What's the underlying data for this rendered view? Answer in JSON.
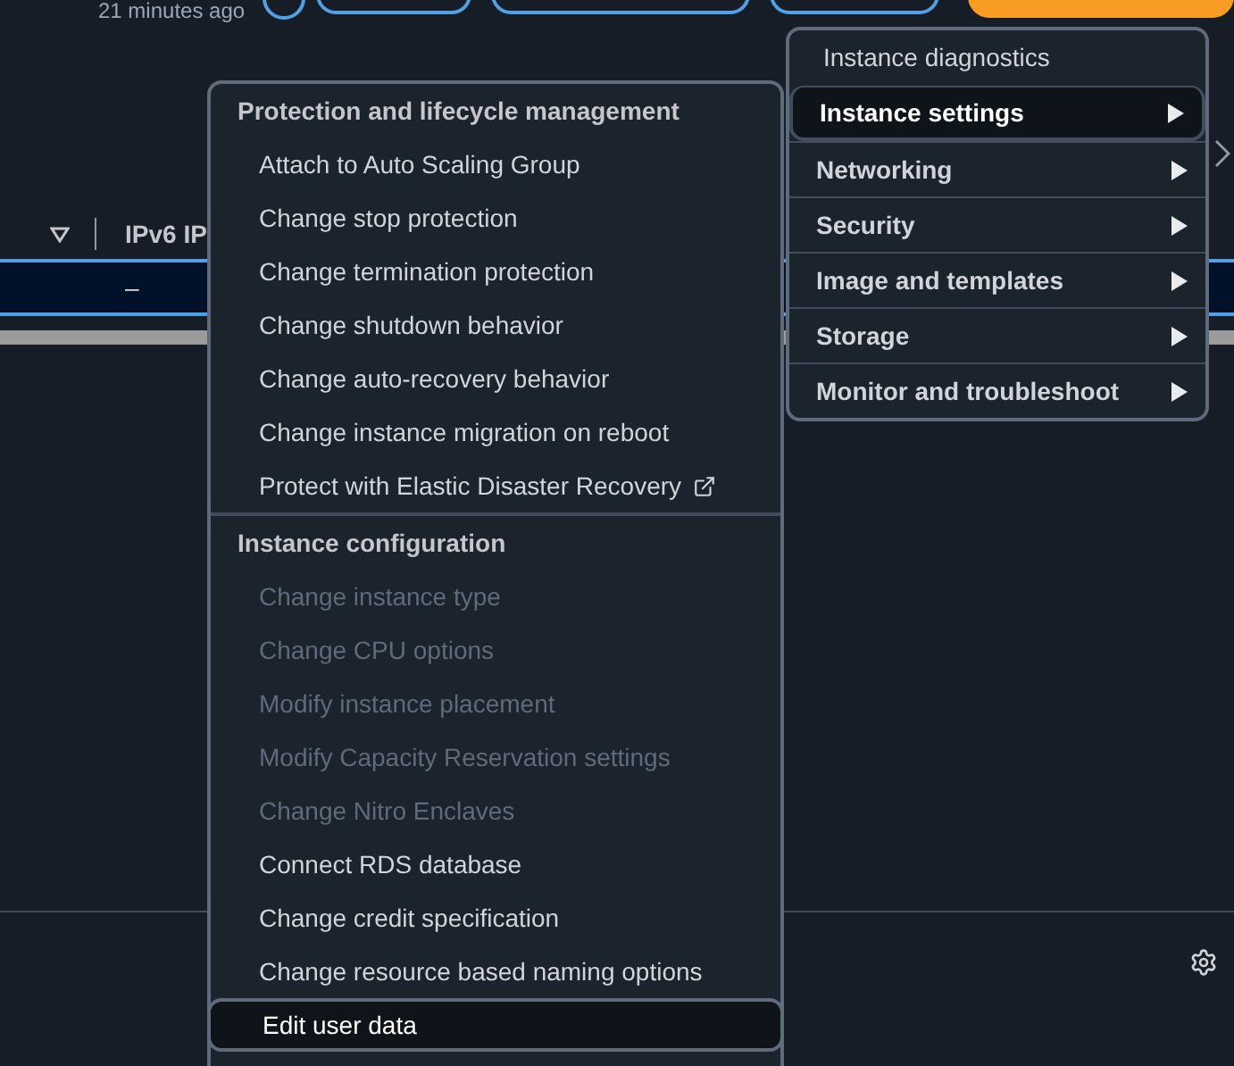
{
  "header": {
    "timestamp": "21 minutes ago"
  },
  "table": {
    "columns": [
      {
        "label": "IPv6 IP"
      }
    ],
    "rows": [
      {
        "cells": [
          "–"
        ],
        "selected": true
      }
    ]
  },
  "actions_menu": {
    "items": [
      {
        "label": "Instance diagnostics",
        "kind": "plain",
        "selected": false
      },
      {
        "label": "Instance settings",
        "kind": "submenu",
        "selected": true
      },
      {
        "label": "Networking",
        "kind": "submenu",
        "selected": false
      },
      {
        "label": "Security",
        "kind": "submenu",
        "selected": false
      },
      {
        "label": "Image and templates",
        "kind": "submenu",
        "selected": false
      },
      {
        "label": "Storage",
        "kind": "submenu",
        "selected": false
      },
      {
        "label": "Monitor and troubleshoot",
        "kind": "submenu",
        "selected": false
      }
    ]
  },
  "settings_submenu": {
    "groups": [
      {
        "title": "Protection and lifecycle management",
        "items": [
          {
            "label": "Attach to Auto Scaling Group",
            "disabled": false,
            "selected": false
          },
          {
            "label": "Change stop protection",
            "disabled": false,
            "selected": false
          },
          {
            "label": "Change termination protection",
            "disabled": false,
            "selected": false
          },
          {
            "label": "Change shutdown behavior",
            "disabled": false,
            "selected": false
          },
          {
            "label": "Change auto-recovery behavior",
            "disabled": false,
            "selected": false
          },
          {
            "label": "Change instance migration on reboot",
            "disabled": false,
            "selected": false
          },
          {
            "label": "Protect with Elastic Disaster Recovery",
            "disabled": false,
            "selected": false,
            "external": true
          }
        ]
      },
      {
        "title": "Instance configuration",
        "items": [
          {
            "label": "Change instance type",
            "disabled": true,
            "selected": false
          },
          {
            "label": "Change CPU options",
            "disabled": true,
            "selected": false
          },
          {
            "label": "Modify instance placement",
            "disabled": true,
            "selected": false
          },
          {
            "label": "Modify Capacity Reservation settings",
            "disabled": true,
            "selected": false
          },
          {
            "label": "Change Nitro Enclaves",
            "disabled": true,
            "selected": false
          },
          {
            "label": "Connect RDS database",
            "disabled": false,
            "selected": false
          },
          {
            "label": "Change credit specification",
            "disabled": false,
            "selected": false
          },
          {
            "label": "Change resource based naming options",
            "disabled": false,
            "selected": false
          },
          {
            "label": "Edit user data",
            "disabled": false,
            "selected": true
          }
        ]
      }
    ]
  }
}
